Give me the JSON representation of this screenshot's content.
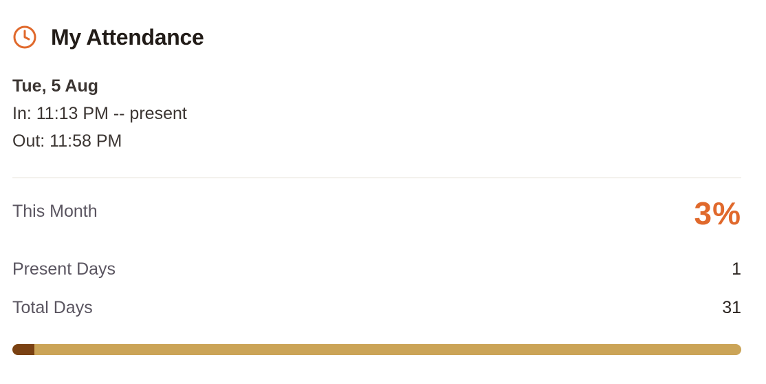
{
  "header": {
    "title": "My Attendance",
    "icon": "clock-icon",
    "accent_color": "#e0692c"
  },
  "today": {
    "date": "Tue, 5 Aug",
    "in_text": "In: 11:13 PM -- present",
    "out_text": "Out: 11:58 PM"
  },
  "month": {
    "label": "This Month",
    "percent_text": "3%",
    "present_label": "Present Days",
    "present_value": "1",
    "total_label": "Total Days",
    "total_value": "31",
    "progress_fraction": 0.03,
    "progress_fill_color": "#7a4113",
    "progress_track_color": "#cba457"
  }
}
